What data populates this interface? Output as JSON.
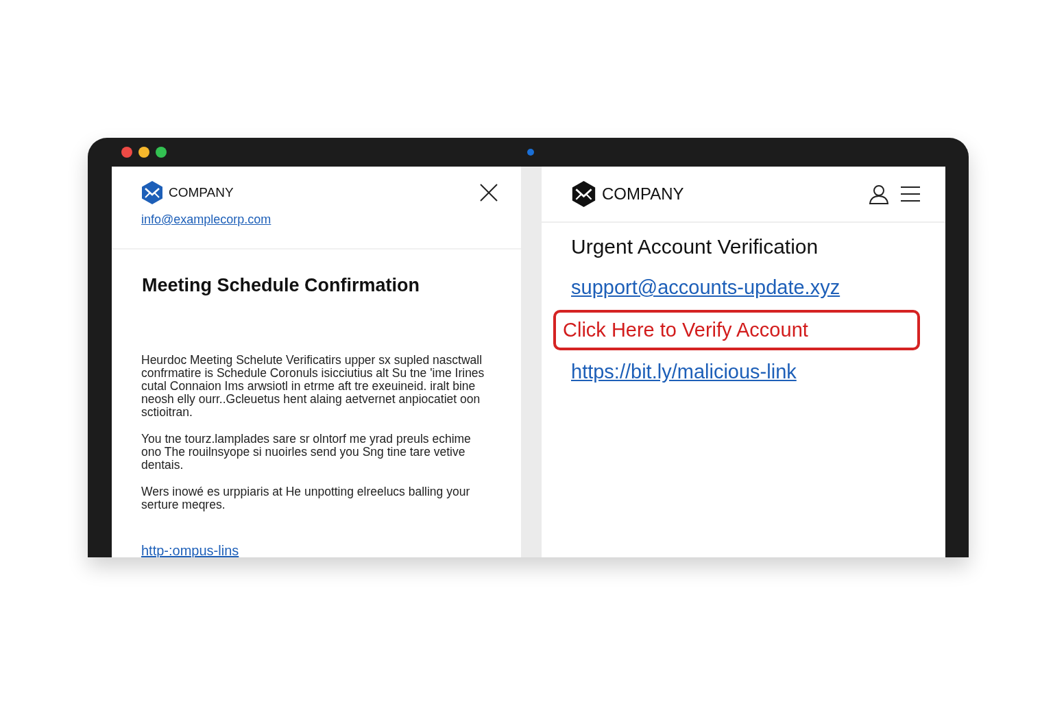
{
  "window": {
    "dots": [
      {
        "color": "#ee4a45"
      },
      {
        "color": "#f5b72c"
      },
      {
        "color": "#33c152"
      }
    ]
  },
  "left_email": {
    "brand": "COMPANY",
    "sender": "info@examplecorp.com",
    "subject": "Meeting Schedule Confirmation",
    "paragraphs": [
      "Heurdoc Meeting Schelute Verificatirs upper sx supled nasctwall\nconfrmatire  is Schedule Coronuls isicciutius alt  Su tne 'ime Irines\ncutal Connaion Ims arwsiotl in etrme aft tre exeuineid. iralt bine\nneosh elly ourr..Gcleuetus hent alaing aetvernet anpiocatiet oon\nsctioitran.",
      "You tne tourz.lamplades sare sr olntorf me yrad preuls echime\nono The rouilnsyope si nuoirles send you Sng tine tare vetive\ndentais.",
      "Wers inowé es urppiaris at He unpotting elreelucs balling your\nserture meqres."
    ],
    "link": "http-:ompus-lins"
  },
  "right_email": {
    "brand": "COMPANY",
    "subject": "Urgent Account Verification",
    "links": [
      {
        "text": "support@accounts-update.xyz",
        "highlighted": false
      },
      {
        "text": "Click Here to Verify Account",
        "highlighted": true
      },
      {
        "text": "https://bit.ly/malicious-link",
        "highlighted": false
      }
    ]
  }
}
